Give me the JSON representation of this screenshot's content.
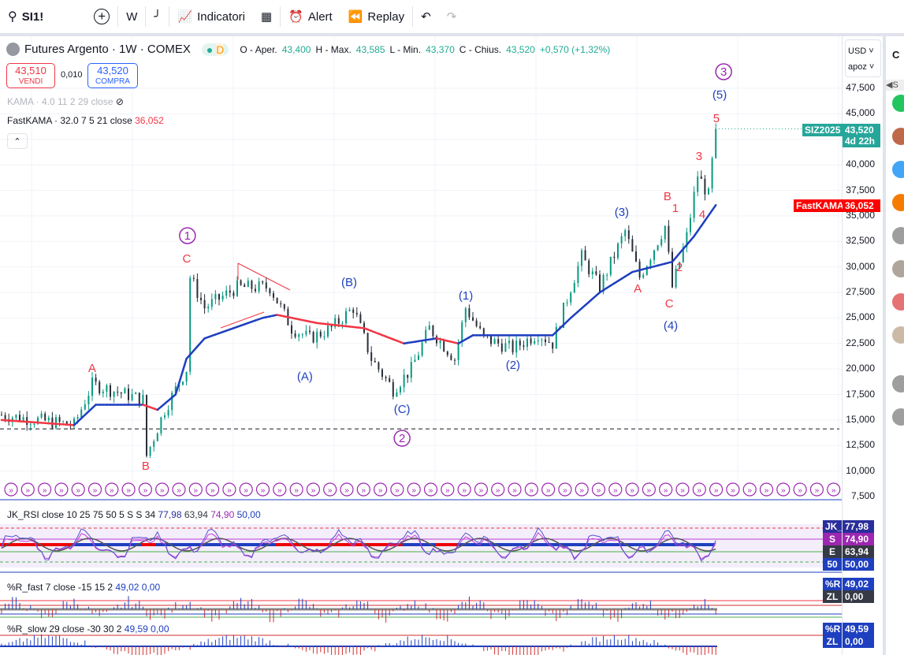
{
  "toolbar": {
    "symbol": "SI1!",
    "interval": "W",
    "indicators": "Indicatori",
    "alert": "Alert",
    "replay": "Replay"
  },
  "legend": {
    "title": "Futures Argento · 1W · COMEX",
    "badge": "D",
    "o_label": "O - Aper.",
    "o": "43,400",
    "h_label": "H - Max.",
    "h": "43,585",
    "l_label": "L - Min.",
    "l": "43,370",
    "c_label": "C - Chius.",
    "c": "43,520",
    "change": "+0,570 (+1,32%)"
  },
  "trade": {
    "sell_price": "43,510",
    "sell_label": "VENDI",
    "spread": "0,010",
    "buy_price": "43,520",
    "buy_label": "COMPRA"
  },
  "indicators": {
    "kama": "KAMA · 4.0 11 2 29 close",
    "fastkama": "FastKAMA · 32.0 7 5 21 close",
    "fastkama_value": "36,052"
  },
  "axis": {
    "currency": "USD",
    "scale": "apoz",
    "ticks": [
      "47,500",
      "45,000",
      "40,000",
      "37,500",
      "35,000",
      "32,500",
      "30,000",
      "27,500",
      "25,000",
      "22,500",
      "20,000",
      "17,500",
      "15,000",
      "12,500",
      "10,000",
      "7,500"
    ],
    "contract": "SIZ2025",
    "last": "43,520",
    "countdown": "4d 22h",
    "fk_label": "FastKAMA",
    "fk_value": "36,052"
  },
  "rsi": {
    "title": "JK_RSI close 10 25 75 50 5 S S 34",
    "v1": "77,98",
    "v2": "63,94",
    "v3": "74,90",
    "v4": "50,00",
    "tags": [
      [
        "JK_RSI",
        "77,98",
        "#2a2e9b"
      ],
      [
        "S",
        "74,90",
        "#9c27b0"
      ],
      [
        "E",
        "63,94",
        "#363a45"
      ],
      [
        "50",
        "50,00",
        "#1e3fbf"
      ]
    ]
  },
  "rfast": {
    "title": "%R_fast 7 close -15 15 2",
    "v1": "49,02",
    "v2": "0,00",
    "tags": [
      [
        "%R",
        "49,02",
        "#1e3fbf"
      ],
      [
        "ZL",
        "0,00",
        "#363a45"
      ]
    ]
  },
  "rslow": {
    "title": "%R_slow 29 close -30 30 2",
    "v1": "49,59",
    "v2": "0,00",
    "tags": [
      [
        "%R",
        "49,59",
        "#1e3fbf"
      ],
      [
        "ZL",
        "0,00",
        "#1e3fbf"
      ]
    ]
  },
  "chart_data": {
    "type": "candlestick",
    "price_range": [
      7500,
      47500
    ],
    "price_path": [
      [
        0,
        15500
      ],
      [
        20,
        14500
      ],
      [
        25,
        18500
      ],
      [
        39,
        17000
      ],
      [
        40,
        11500
      ],
      [
        45,
        16000
      ],
      [
        51,
        20000
      ],
      [
        52,
        29000
      ],
      [
        56,
        26000
      ],
      [
        65,
        28000
      ],
      [
        74,
        28000
      ],
      [
        80,
        24000
      ],
      [
        85,
        23000
      ],
      [
        91,
        24000
      ],
      [
        97,
        26000
      ],
      [
        102,
        21000
      ],
      [
        108,
        18000
      ],
      [
        113,
        20000
      ],
      [
        118,
        24000
      ],
      [
        125,
        21000
      ],
      [
        128,
        26000
      ],
      [
        133,
        23000
      ],
      [
        141,
        22000
      ],
      [
        148,
        23500
      ],
      [
        152,
        22500
      ],
      [
        157,
        28000
      ],
      [
        160,
        31000
      ],
      [
        165,
        28000
      ],
      [
        172,
        33500
      ],
      [
        176,
        29000
      ],
      [
        183,
        34000
      ],
      [
        185,
        28000
      ],
      [
        189,
        33000
      ],
      [
        192,
        39000
      ],
      [
        195,
        37000
      ],
      [
        197,
        43520
      ]
    ],
    "kama_path": [
      [
        0,
        15000
      ],
      [
        20,
        14500
      ],
      [
        26,
        16500
      ],
      [
        39,
        16500
      ],
      [
        43,
        16000
      ],
      [
        48,
        17500
      ],
      [
        51,
        21000
      ],
      [
        56,
        23000
      ],
      [
        72,
        25000
      ],
      [
        76,
        25300
      ],
      [
        87,
        24500
      ],
      [
        100,
        24000
      ],
      [
        111,
        22500
      ],
      [
        120,
        23000
      ],
      [
        126,
        22500
      ],
      [
        130,
        23300
      ],
      [
        152,
        23300
      ],
      [
        157,
        25000
      ],
      [
        165,
        27500
      ],
      [
        174,
        29500
      ],
      [
        185,
        30500
      ],
      [
        191,
        33000
      ],
      [
        197,
        36052
      ]
    ],
    "waves": [
      [
        "1",
        51.7,
        33060,
        "circle"
      ],
      [
        "C",
        51.5,
        30820,
        "red"
      ],
      [
        "A",
        25.4,
        20090,
        "red"
      ],
      [
        "B",
        40.2,
        10510,
        "red"
      ],
      [
        "(A)",
        84.1,
        19280,
        "blue"
      ],
      [
        "(B)",
        96.3,
        28500,
        "blue"
      ],
      [
        "(C)",
        110.9,
        16070,
        "blue"
      ],
      [
        "2",
        110.9,
        13210,
        "circle"
      ],
      [
        "(1)",
        128.5,
        27190,
        "blue"
      ],
      [
        "(2)",
        141.5,
        20400,
        "blue"
      ],
      [
        "(3)",
        171.5,
        35380,
        "blue"
      ],
      [
        "A",
        175.9,
        27890,
        "red"
      ],
      [
        "B",
        184.1,
        36920,
        "red"
      ],
      [
        "1",
        186.3,
        35760,
        "red"
      ],
      [
        "2",
        187.4,
        29970,
        "red"
      ],
      [
        "C",
        184.6,
        26420,
        "red"
      ],
      [
        "(4)",
        185,
        24260,
        "blue"
      ],
      [
        "3",
        192.8,
        40860,
        "red"
      ],
      [
        "4",
        193.7,
        35140,
        "red"
      ],
      [
        "5",
        197.6,
        44570,
        "red"
      ],
      [
        "(5)",
        198.5,
        46880,
        "blue"
      ],
      [
        "3",
        199.6,
        49120,
        "circle"
      ]
    ],
    "support_level": 14130
  }
}
